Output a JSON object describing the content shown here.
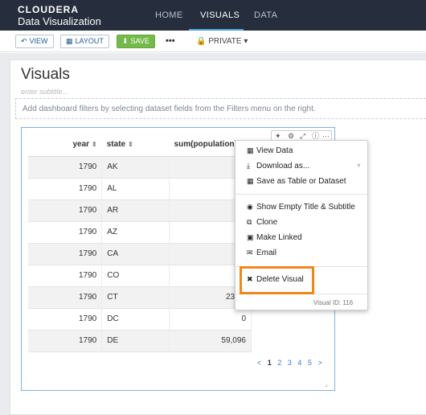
{
  "app": {
    "brand": "CLOUDERA",
    "subtitle": "Data Visualization",
    "tabs": [
      "HOME",
      "VISUALS",
      "DATA"
    ],
    "active_tab": "VISUALS"
  },
  "toolbar": {
    "view": "VIEW",
    "layout": "LAYOUT",
    "save": "SAVE",
    "more": "•••",
    "private": "PRIVATE"
  },
  "dashboard": {
    "title": "Visuals",
    "subtitle_placeholder": "enter subtitle...",
    "filter_hint": "Add dashboard filters by selecting dataset fields from the Filters menu on the right."
  },
  "table": {
    "columns": [
      "year",
      "state",
      "sum(population)"
    ],
    "rows": [
      [
        "1790",
        "AK",
        ""
      ],
      [
        "1790",
        "AL",
        ""
      ],
      [
        "1790",
        "AR",
        ""
      ],
      [
        "1790",
        "AZ",
        ""
      ],
      [
        "1790",
        "CA",
        ""
      ],
      [
        "1790",
        "CO",
        ""
      ],
      [
        "1790",
        "CT",
        "237,9"
      ],
      [
        "1790",
        "DC",
        "0"
      ],
      [
        "1790",
        "DE",
        "59,096"
      ]
    ]
  },
  "pagination": {
    "prev": "<",
    "pages": [
      "1",
      "2",
      "3",
      "4",
      "5"
    ],
    "next": ">",
    "current": "1"
  },
  "menu": {
    "items": [
      "View Data",
      "Download as...",
      "Save as Table or Dataset",
      "Show Empty Title & Subtitle",
      "Clone",
      "Make Linked",
      "Email",
      "Delete Visual"
    ],
    "visual_id": "Visual ID: 116"
  },
  "colors": {
    "nav_bg": "#262e3d",
    "save_green": "#74b949",
    "highlight": "#f0861e",
    "card_border": "#7fb2e5"
  }
}
